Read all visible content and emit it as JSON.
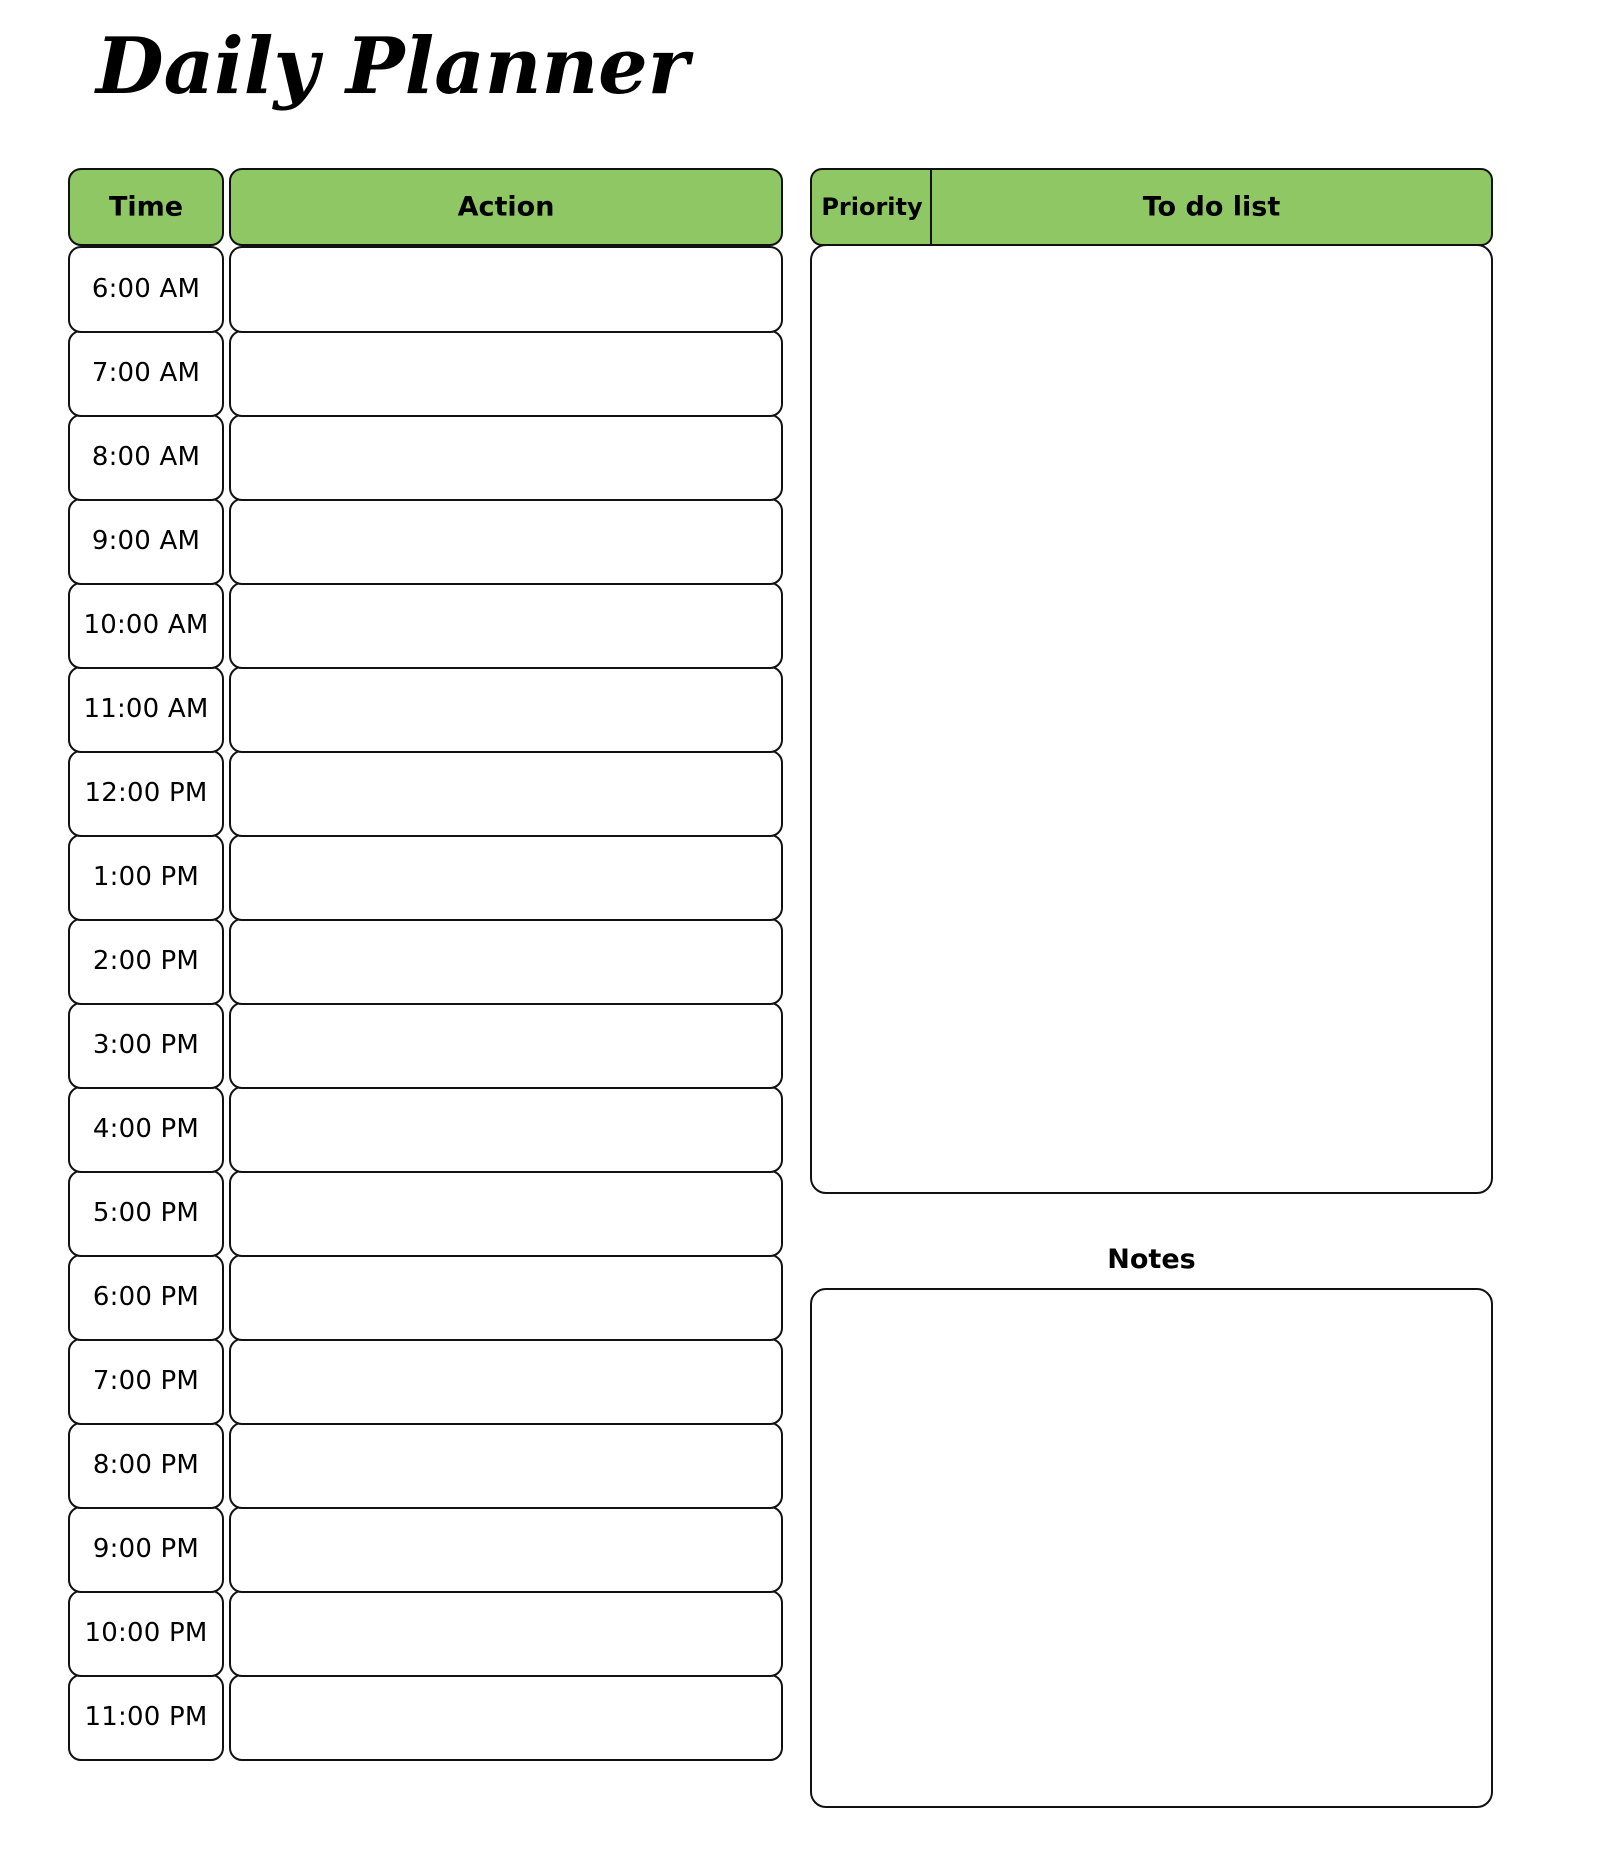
{
  "page": {
    "title": "Daily Planner",
    "background_color": "#ffffff",
    "accent_green": "#8fc765",
    "border_color": "#111111"
  },
  "schedule": {
    "headers": {
      "time": "Time",
      "action": "Action"
    },
    "rows": [
      {
        "time": "6:00 AM",
        "action": ""
      },
      {
        "time": "7:00 AM",
        "action": ""
      },
      {
        "time": "8:00 AM",
        "action": ""
      },
      {
        "time": "9:00 AM",
        "action": ""
      },
      {
        "time": "10:00 AM",
        "action": ""
      },
      {
        "time": "11:00 AM",
        "action": ""
      },
      {
        "time": "12:00 PM",
        "action": ""
      },
      {
        "time": "1:00 PM",
        "action": ""
      },
      {
        "time": "2:00 PM",
        "action": ""
      },
      {
        "time": "3:00 PM",
        "action": ""
      },
      {
        "time": "4:00 PM",
        "action": ""
      },
      {
        "time": "5:00 PM",
        "action": ""
      },
      {
        "time": "6:00 PM",
        "action": ""
      },
      {
        "time": "7:00 PM",
        "action": ""
      },
      {
        "time": "8:00 PM",
        "action": ""
      },
      {
        "time": "9:00 PM",
        "action": ""
      },
      {
        "time": "10:00 PM",
        "action": ""
      },
      {
        "time": "11:00 PM",
        "action": ""
      }
    ]
  },
  "todo": {
    "priority_header": "Priority",
    "list_header": "To do list",
    "body_text": ""
  },
  "notes": {
    "label": "Notes",
    "body_text": ""
  }
}
